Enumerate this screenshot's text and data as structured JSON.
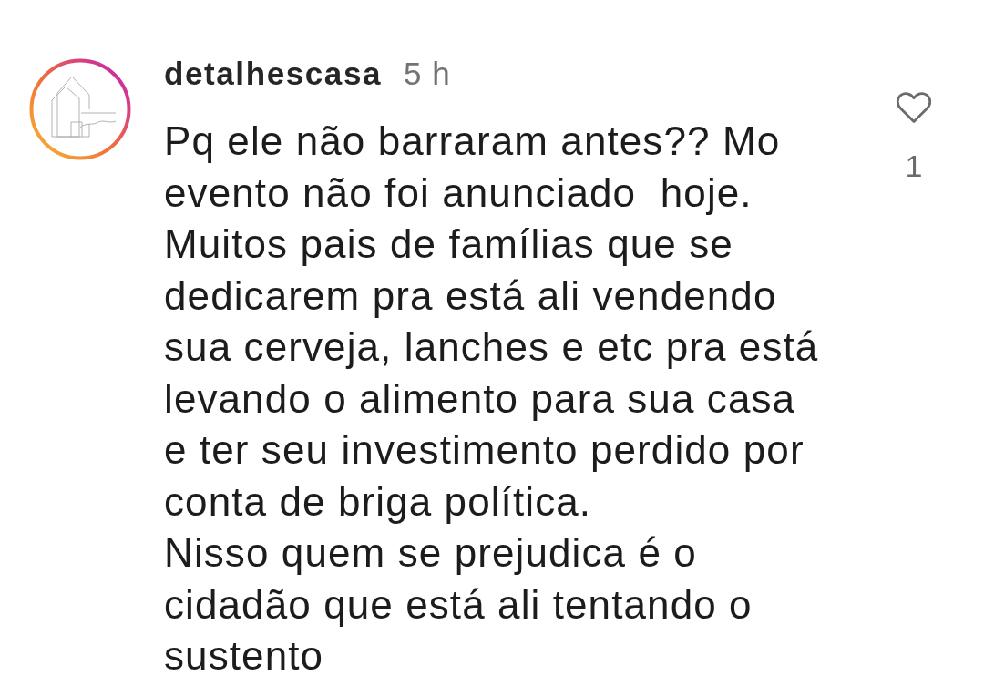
{
  "comment": {
    "username": "detalhescasa",
    "time": "5 h",
    "text": "Pq ele não barraram antes?? Mo\nevento não foi anunciado  hoje.\nMuitos pais de famílias que se\ndedicarem pra está ali vendendo\nsua cerveja, lanches e etc pra está\nlevando o alimento para sua casa\ne ter seu investimento perdido por\nconta de briga política.\nNisso quem se prejudica é o\ncidadão que está ali tentando o\nsustento",
    "liked": false,
    "like_count": "1"
  }
}
